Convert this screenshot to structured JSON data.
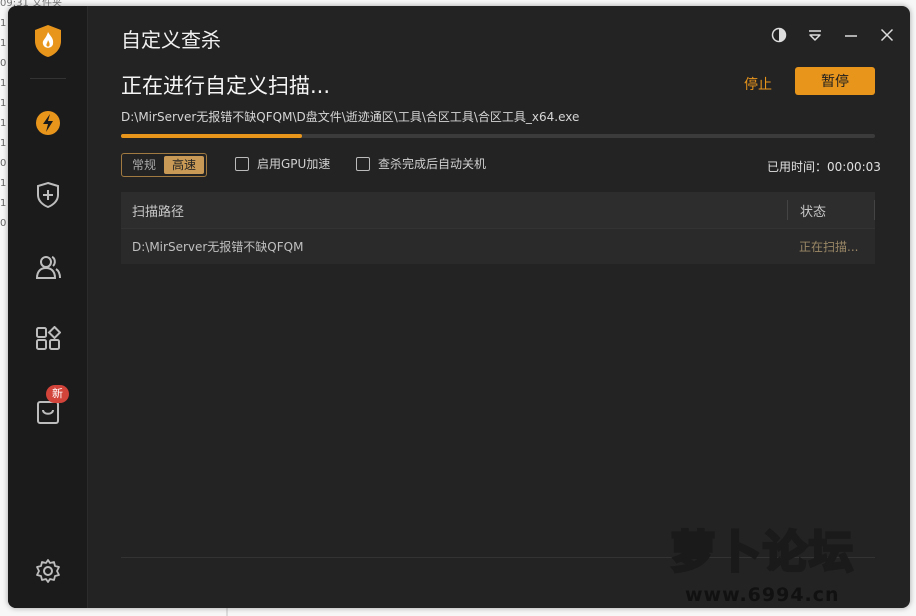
{
  "background": {
    "top_text": "09:31   文件夹",
    "row_digits": [
      "1",
      "1",
      "0",
      "1",
      "1",
      "1",
      "1",
      "0",
      "1",
      "1",
      "0"
    ]
  },
  "window": {
    "title": "自定义查杀",
    "controls": [
      "theme-icon",
      "menu-icon",
      "minimize-icon",
      "close-icon"
    ]
  },
  "sidebar": {
    "badge": "新",
    "icons": [
      "logo-icon",
      "speed-icon",
      "shield-plus-icon",
      "users-icon",
      "apps-icon",
      "bag-icon",
      "gear-icon"
    ]
  },
  "scan": {
    "heading": "正在进行自定义扫描...",
    "stop_label": "停止",
    "pause_label": "暂停",
    "current_path": "D:\\MirServer无报错不缺QFQM\\D盘文件\\逝迹通区\\工具\\合区工具\\合区工具_x64.exe",
    "progress_fraction": 0.24
  },
  "options": {
    "mode_normal": "常规",
    "mode_fast": "高速",
    "gpu_label": "启用GPU加速",
    "shutdown_label": "查杀完成后自动关机",
    "elapsed": "已用时间：00:00:03"
  },
  "table": {
    "headers": {
      "path": "扫描路径",
      "status": "状态"
    },
    "rows": [
      {
        "path": "D:\\MirServer无报错不缺QFQM",
        "status": "正在扫描..."
      }
    ]
  },
  "watermark": {
    "title": "萝卜论坛",
    "url": "www.6994.cn"
  },
  "colors": {
    "accent": "#e8951c",
    "bg": "#232323",
    "sidebar": "#1b1b1b",
    "badge": "#d2433a"
  }
}
